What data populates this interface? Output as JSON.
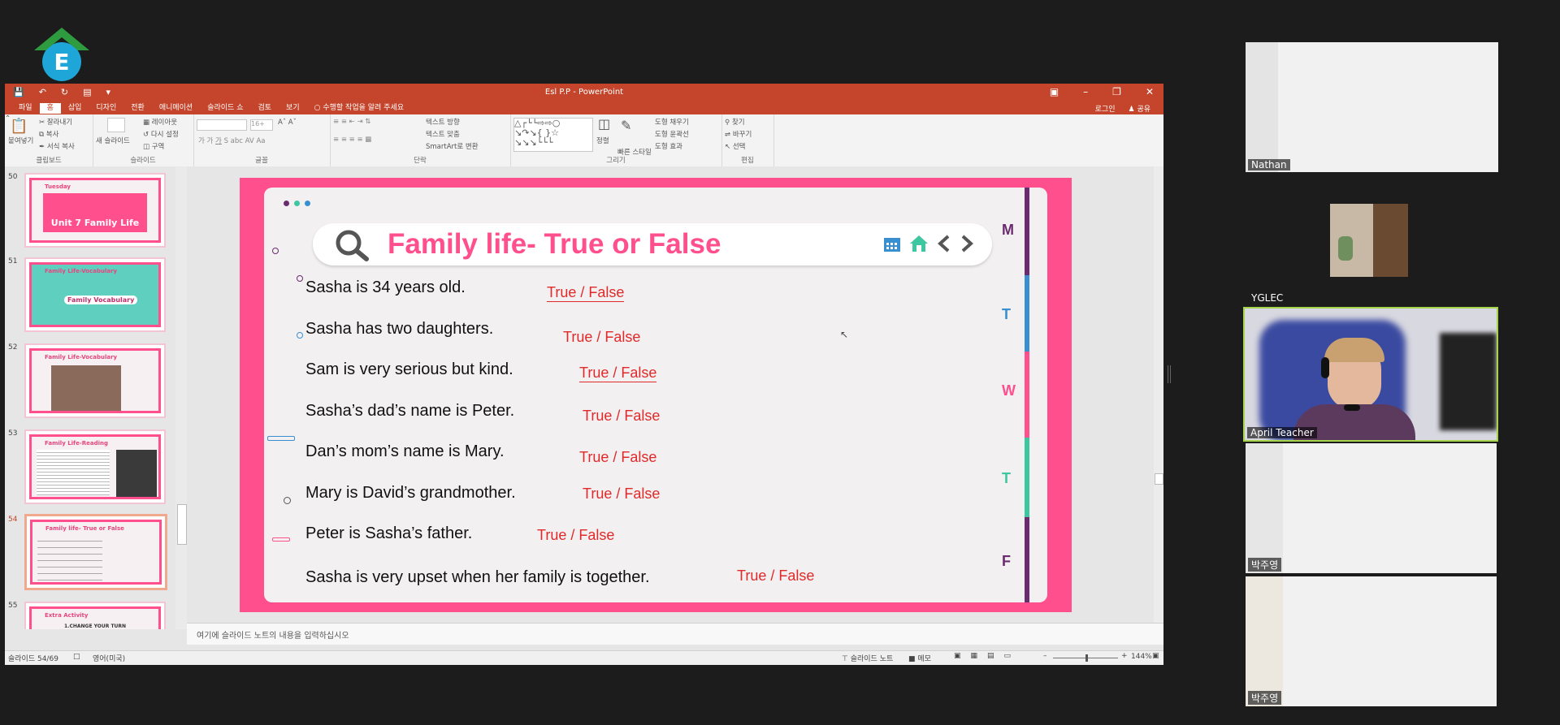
{
  "window": {
    "title": "Esl P.P - PowerPoint"
  },
  "menu": {
    "tabs": [
      "파일",
      "홈",
      "삽입",
      "디자인",
      "전환",
      "애니메이션",
      "슬라이드 쇼",
      "검토",
      "보기"
    ],
    "tell_me": "수행할 작업을 알려 주세요",
    "login": "로그인",
    "share": "공유"
  },
  "ribbon": {
    "clipboard": {
      "paste": "붙여넣기",
      "cut": "잘라내기",
      "copy": "복사",
      "format_copy": "서식 복사",
      "label": "클립보드"
    },
    "slides": {
      "new_slide": "새 슬라이드",
      "layout": "레이아웃",
      "reset": "다시 설정",
      "section": "구역",
      "label": "슬라이드"
    },
    "font": {
      "size": "16+",
      "label": "글꼴"
    },
    "paragraph": {
      "text_direction": "텍스트 방향",
      "align_text": "텍스트 맞춤",
      "smartart": "SmartArt로 변환",
      "label": "단락"
    },
    "drawing": {
      "arrange": "정렬",
      "quick_styles": "빠른 스타일",
      "shape_fill": "도형 채우기",
      "shape_outline": "도형 윤곽선",
      "shape_effects": "도형 효과",
      "label": "그리기"
    },
    "editing": {
      "find": "찾기",
      "replace": "바꾸기",
      "select": "선택",
      "label": "편집"
    }
  },
  "thumbnails": [
    {
      "num": "50",
      "title": "Tuesday",
      "subtitle": "Unit 7 Family Life"
    },
    {
      "num": "51",
      "title": "Family Life-Vocabulary",
      "subtitle": "Family Vocabulary"
    },
    {
      "num": "52",
      "title": "Family Life-Vocabulary",
      "subtitle": ""
    },
    {
      "num": "53",
      "title": "Family Life-Reading",
      "subtitle": ""
    },
    {
      "num": "54",
      "title": "Family life- True or False",
      "subtitle": ""
    },
    {
      "num": "55",
      "title": "Extra Activity",
      "subtitle": "1.CHANGE YOUR TURN"
    }
  ],
  "slide": {
    "title": "Family life- True or False",
    "questions": [
      {
        "text": "Sasha is 34 years old.",
        "answer": "True / False"
      },
      {
        "text": "Sasha has two daughters.",
        "answer": "True / False"
      },
      {
        "text": "Sam is very serious but kind.",
        "answer": "True / False"
      },
      {
        "text": "Sasha’s dad’s name is Peter.",
        "answer": "True / False"
      },
      {
        "text": "Dan’s mom’s name is Mary.",
        "answer": "True / False"
      },
      {
        "text": "Mary is David’s grandmother.",
        "answer": "True / False"
      },
      {
        "text": "Peter is Sasha’s father.",
        "answer": "True / False"
      },
      {
        "text": "Sasha is very upset when her family is together.",
        "answer": "True / False"
      }
    ],
    "days": [
      "M",
      "T",
      "W",
      "T",
      "F"
    ],
    "day_colors": [
      "#6a2c6e",
      "#3a8fd0",
      "#ff4f8d",
      "#3cc7a0",
      "#6a2c6e"
    ]
  },
  "notes": {
    "placeholder": "여기에 슬라이드 노트의 내용을 입력하십시오"
  },
  "status": {
    "slide_count": "슬라이드 54/69",
    "language": "영어(미국)",
    "notes_btn": "슬라이드 노트",
    "comments_btn": "메모",
    "zoom": "144%"
  },
  "participants": [
    {
      "name": "Nathan"
    },
    {
      "name": "YGLEC"
    },
    {
      "name": "April Teacher"
    },
    {
      "name": "박주영"
    },
    {
      "name": "박주영"
    }
  ]
}
